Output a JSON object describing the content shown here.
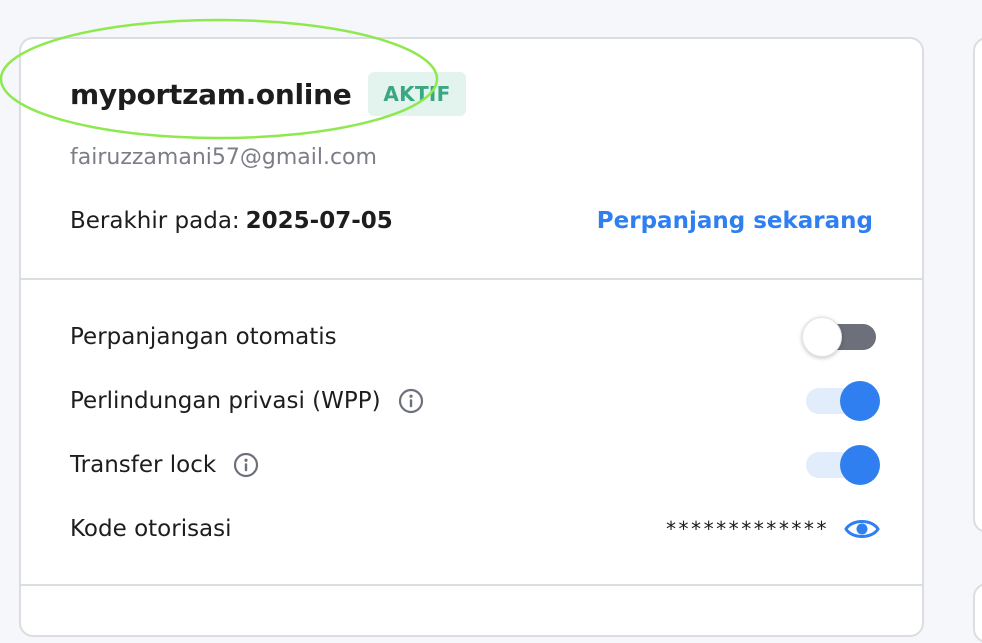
{
  "domain_card": {
    "domain_name": "myportzam.online",
    "status_badge": "AKTIF",
    "email": "fairuzzamani57@gmail.com",
    "expiry_label": "Berakhir pada:",
    "expiry_date": "2025-07-05",
    "renew_link": "Perpanjang sekarang"
  },
  "settings": [
    {
      "label": "Perpanjangan otomatis",
      "control": "toggle",
      "enabled": false
    },
    {
      "label": "Perlindungan privasi (WPP)",
      "control": "toggle",
      "enabled": true,
      "info_icon": "info-icon"
    },
    {
      "label": "Transfer lock",
      "control": "toggle",
      "enabled": true,
      "info_icon": "info-icon"
    },
    {
      "label": "Kode otorisasi",
      "control": "masked-value",
      "value": "*************",
      "icon": "eye-icon"
    }
  ],
  "colors": {
    "accent": "#2f7ff0",
    "badge_bg": "#e3f3ee",
    "badge_text": "#3aa783",
    "annotation_ellipse": "#8ee94f"
  }
}
